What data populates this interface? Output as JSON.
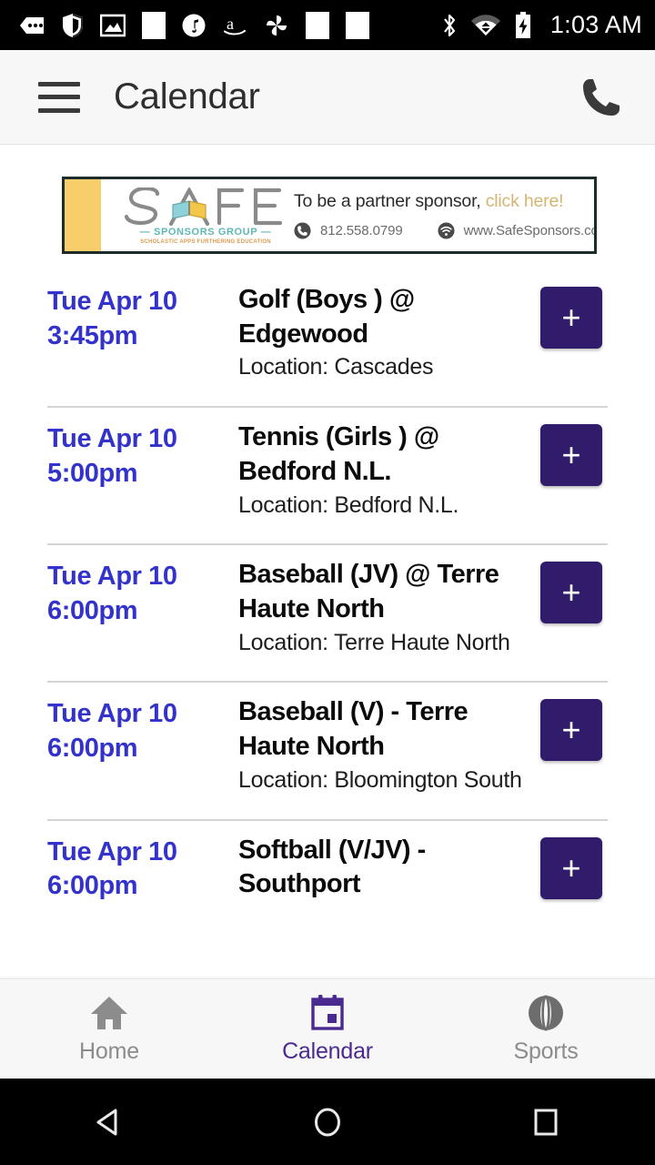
{
  "statusbar": {
    "time": "1:03 AM",
    "icons_left": [
      "messages-icon",
      "shield-icon",
      "photos-icon",
      "blank-app-icon",
      "music-icon",
      "amazon-icon",
      "pinwheel-icon",
      "blank-app-icon-2",
      "blank-app-icon-3"
    ],
    "icons_right": [
      "bluetooth-icon",
      "wifi-icon",
      "battery-charging-icon"
    ]
  },
  "appbar": {
    "title": "Calendar",
    "menu_icon": "hamburger-menu-icon",
    "phone_icon": "phone-icon"
  },
  "banner": {
    "logo_word": "SAFE",
    "logo_sub1": "— SPONSORS GROUP —",
    "logo_sub2": "SCHOLASTIC APPS FURTHERING EDUCATION",
    "headline": "To be a partner sponsor,",
    "cta": "click here!",
    "phone": "812.558.0799",
    "website": "www.SafeSponsors.com",
    "stripe_left_color": "#f8ce6a",
    "stripe_right_color": "#a9dce1",
    "cta_color": "#d4b572"
  },
  "events": [
    {
      "date": "Tue Apr 10",
      "time": "3:45pm",
      "title": "Golf (Boys ) @ Edgewood",
      "location": "Location: Cascades",
      "add_label": "+"
    },
    {
      "date": "Tue Apr 10",
      "time": "5:00pm",
      "title": "Tennis (Girls ) @ Bedford N.L.",
      "location": "Location: Bedford N.L.",
      "add_label": "+"
    },
    {
      "date": "Tue Apr 10",
      "time": "6:00pm",
      "title": "Baseball (JV) @ Terre Haute North",
      "location": "Location: Terre Haute North",
      "add_label": "+"
    },
    {
      "date": "Tue Apr 10",
      "time": "6:00pm",
      "title": "Baseball (V) - Terre Haute North",
      "location": "Location: Bloomington South",
      "add_label": "+"
    },
    {
      "date": "Tue Apr 10",
      "time": "6:00pm",
      "title": "Softball (V/JV) - Southport",
      "location": "",
      "add_label": "+"
    }
  ],
  "bottomnav": {
    "items": [
      {
        "label": "Home",
        "icon": "home-icon",
        "active": false
      },
      {
        "label": "Calendar",
        "icon": "calendar-icon",
        "active": true
      },
      {
        "label": "Sports",
        "icon": "baseball-icon",
        "active": false
      }
    ],
    "active_color": "#4b2a8f",
    "inactive_color": "#8c8c8c"
  },
  "androidnav": {
    "back": "back-triangle-icon",
    "home": "home-circle-icon",
    "recents": "recents-square-icon"
  },
  "theme": {
    "accent_purple": "#311b6b",
    "date_blue": "#3333cc"
  }
}
